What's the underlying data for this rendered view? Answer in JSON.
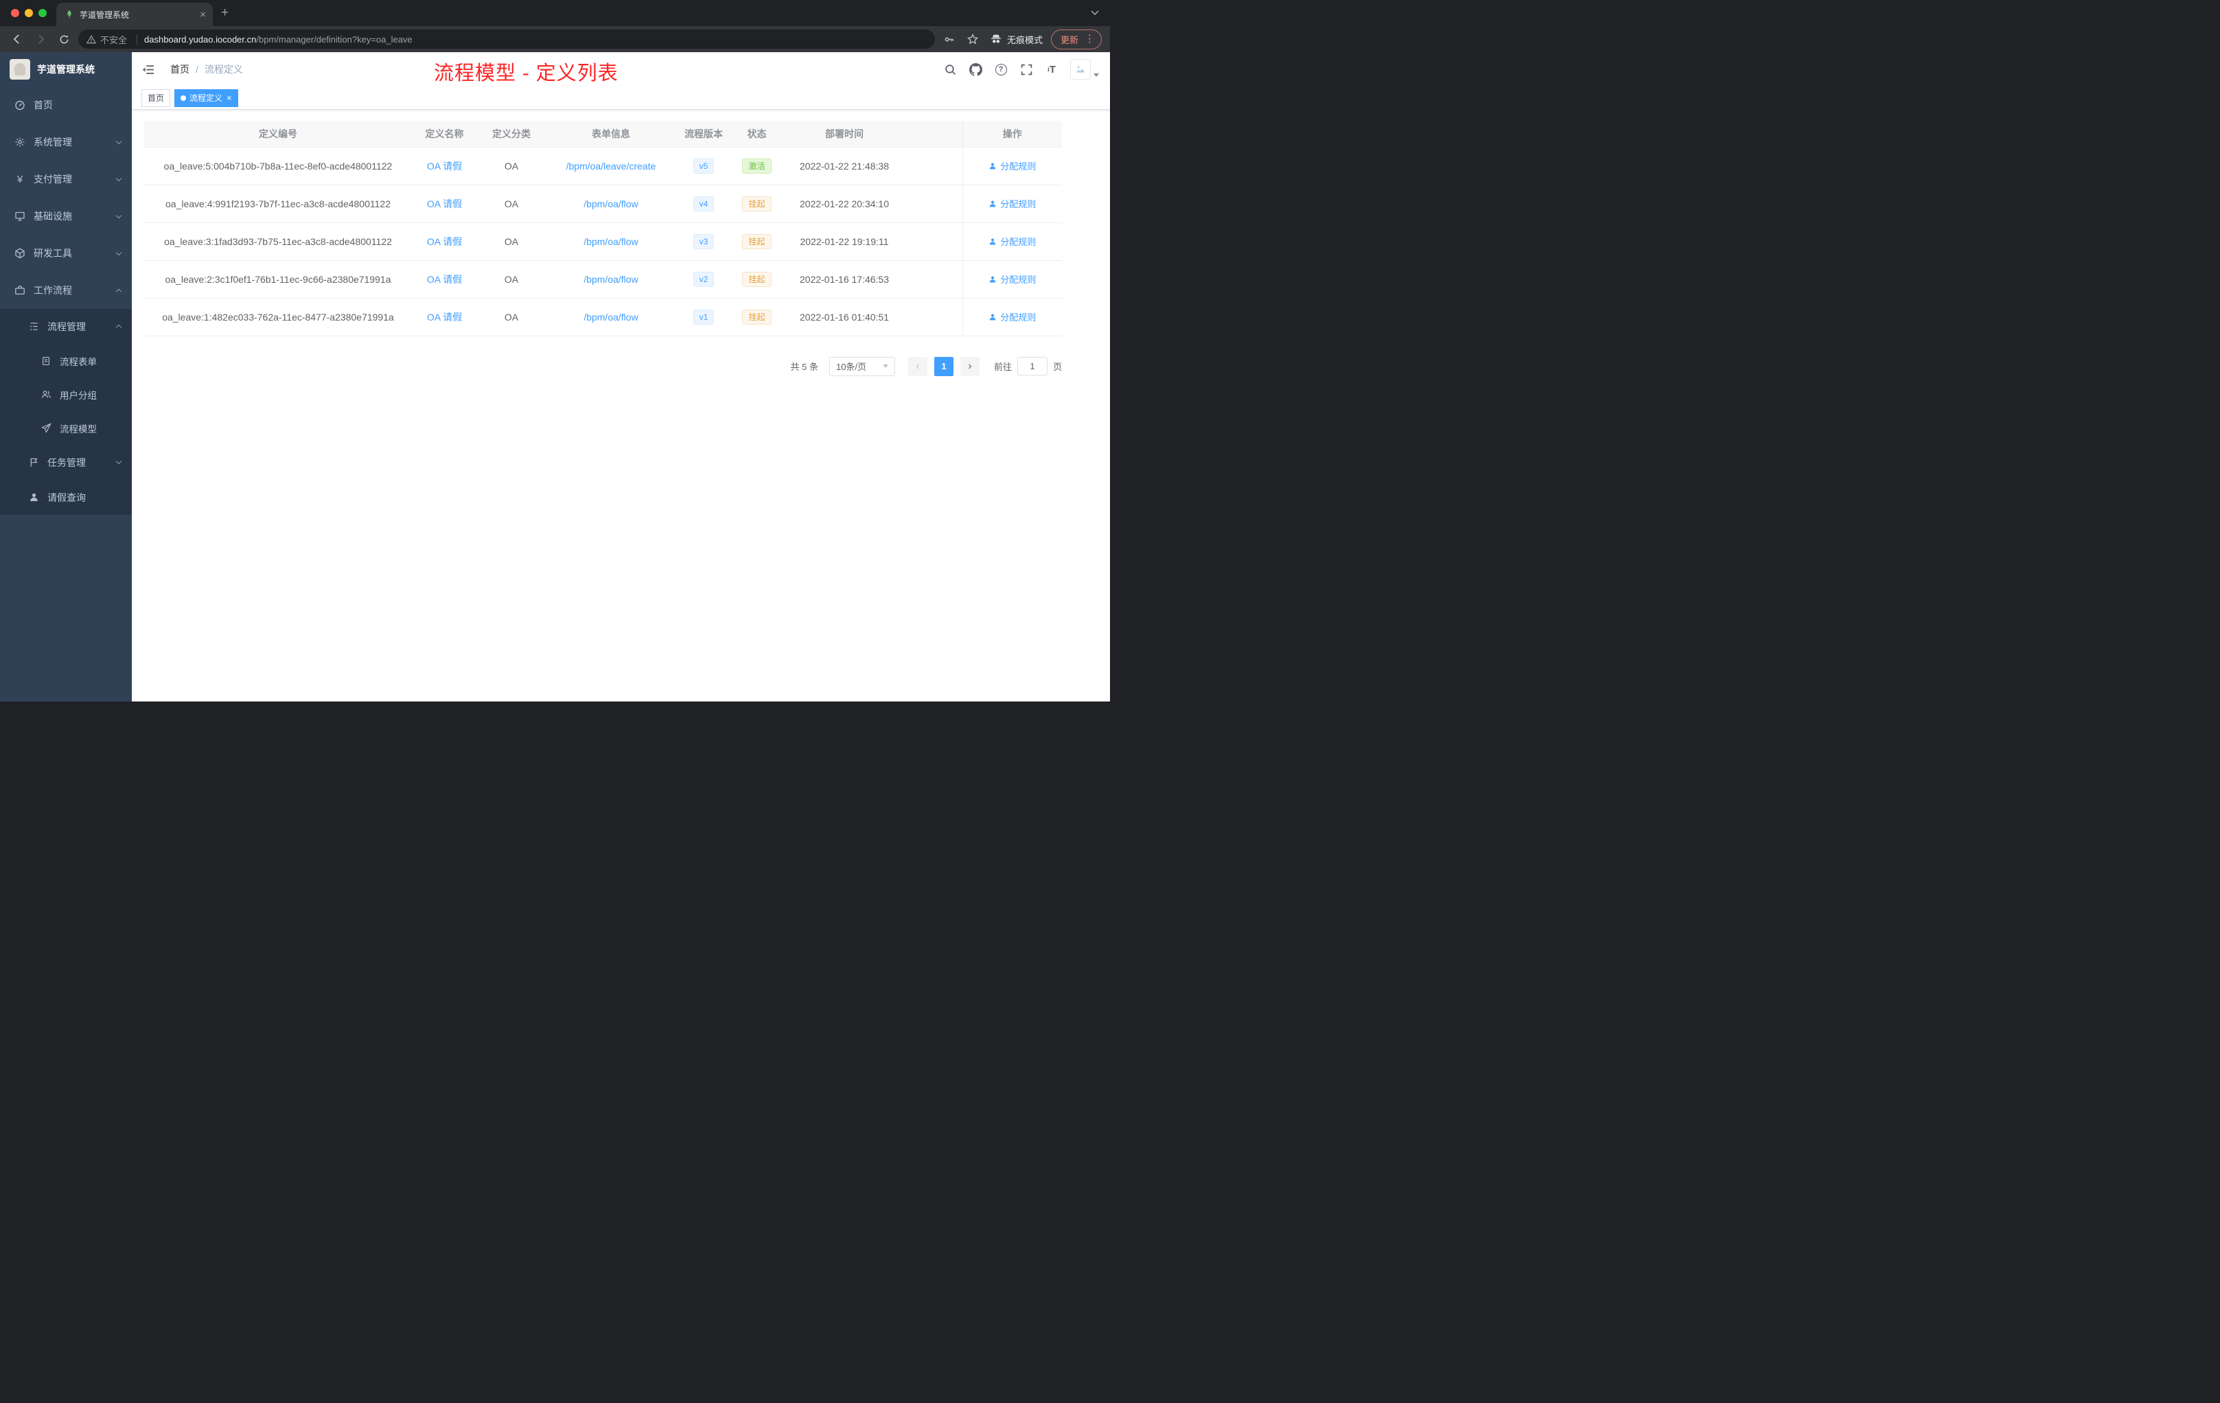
{
  "browser": {
    "tab_title": "芋道管理系统",
    "security_label": "不安全",
    "url_host": "dashboard.yudao.iocoder.cn",
    "url_path": "/bpm/manager/definition?key=oa_leave",
    "incognito_label": "无痕模式",
    "update_label": "更新"
  },
  "sidebar": {
    "logo_title": "芋道管理系统",
    "items": [
      {
        "label": "首页"
      },
      {
        "label": "系统管理"
      },
      {
        "label": "支付管理"
      },
      {
        "label": "基础设施"
      },
      {
        "label": "研发工具"
      },
      {
        "label": "工作流程"
      },
      {
        "label": "流程管理"
      },
      {
        "label": "流程表单"
      },
      {
        "label": "用户分组"
      },
      {
        "label": "流程模型"
      },
      {
        "label": "任务管理"
      },
      {
        "label": "请假查询"
      }
    ]
  },
  "navbar": {
    "breadcrumb_home": "首页",
    "breadcrumb_current": "流程定义",
    "annotation": "流程模型 - 定义列表"
  },
  "tags": {
    "home": "首页",
    "current": "流程定义"
  },
  "table": {
    "columns": [
      "定义编号",
      "定义名称",
      "定义分类",
      "表单信息",
      "流程版本",
      "状态",
      "部署时间",
      "操作"
    ],
    "action_label": "分配规则",
    "rows": [
      {
        "id": "oa_leave:5:004b710b-7b8a-11ec-8ef0-acde48001122",
        "name": "OA 请假",
        "category": "OA",
        "form": "/bpm/oa/leave/create",
        "version": "v5",
        "status": "激活",
        "time": "2022-01-22 21:48:38"
      },
      {
        "id": "oa_leave:4:991f2193-7b7f-11ec-a3c8-acde48001122",
        "name": "OA 请假",
        "category": "OA",
        "form": "/bpm/oa/flow",
        "version": "v4",
        "status": "挂起",
        "time": "2022-01-22 20:34:10"
      },
      {
        "id": "oa_leave:3:1fad3d93-7b75-11ec-a3c8-acde48001122",
        "name": "OA 请假",
        "category": "OA",
        "form": "/bpm/oa/flow",
        "version": "v3",
        "status": "挂起",
        "time": "2022-01-22 19:19:11"
      },
      {
        "id": "oa_leave:2:3c1f0ef1-76b1-11ec-9c66-a2380e71991a",
        "name": "OA 请假",
        "category": "OA",
        "form": "/bpm/oa/flow",
        "version": "v2",
        "status": "挂起",
        "time": "2022-01-16 17:46:53"
      },
      {
        "id": "oa_leave:1:482ec033-762a-11ec-8477-a2380e71991a",
        "name": "OA 请假",
        "category": "OA",
        "form": "/bpm/oa/flow",
        "version": "v1",
        "status": "挂起",
        "time": "2022-01-16 01:40:51"
      }
    ]
  },
  "pagination": {
    "total": "共 5 条",
    "page_size": "10条/页",
    "current_page": "1",
    "goto_prefix": "前往",
    "goto_value": "1",
    "goto_suffix": "页"
  },
  "colors": {
    "accent_blue": "#409eff",
    "success_green": "#67c23a",
    "warning_orange": "#e6a23c",
    "annotation_red": "#fe2525",
    "sidebar_bg": "#304156"
  }
}
